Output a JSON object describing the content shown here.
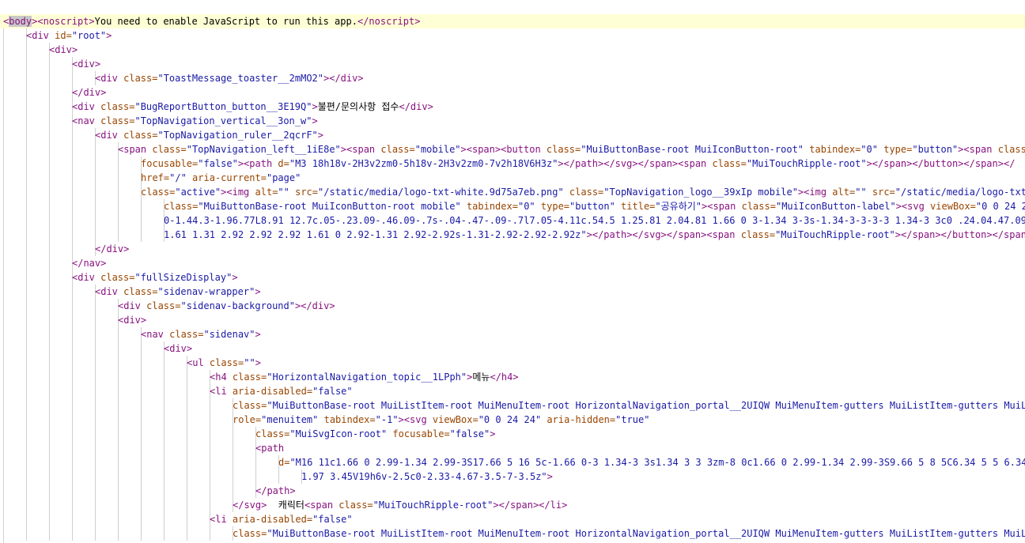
{
  "colors": {
    "tag": "#881280",
    "attr": "#994500",
    "value": "#1a1aa6",
    "text": "#000000",
    "line_highlight": "#ffffd5",
    "token_highlight": "#c8c8c8"
  },
  "lines": [
    {
      "indent": 0,
      "highlight": true,
      "tokens": [
        {
          "t": "tag",
          "v": "<"
        },
        {
          "t": "hl",
          "v": "body"
        },
        {
          "t": "tag",
          "v": "><noscript>"
        },
        {
          "t": "text",
          "v": "You need to enable JavaScript to run this app."
        },
        {
          "t": "tag",
          "v": "</noscript>"
        }
      ]
    },
    {
      "indent": 1,
      "tokens": [
        {
          "t": "tag",
          "v": "<div "
        },
        {
          "t": "attr",
          "v": "id="
        },
        {
          "t": "val",
          "v": "\"root\""
        },
        {
          "t": "tag",
          "v": ">"
        }
      ]
    },
    {
      "indent": 2,
      "tokens": [
        {
          "t": "tag",
          "v": "<div>"
        }
      ]
    },
    {
      "indent": 3,
      "tokens": [
        {
          "t": "tag",
          "v": "<div>"
        }
      ]
    },
    {
      "indent": 4,
      "tokens": [
        {
          "t": "tag",
          "v": "<div "
        },
        {
          "t": "attr",
          "v": "class="
        },
        {
          "t": "val",
          "v": "\"ToastMessage_toaster__2mMO2\""
        },
        {
          "t": "tag",
          "v": "></div>"
        }
      ]
    },
    {
      "indent": 3,
      "tokens": [
        {
          "t": "tag",
          "v": "</div>"
        }
      ]
    },
    {
      "indent": 3,
      "tokens": [
        {
          "t": "tag",
          "v": "<div "
        },
        {
          "t": "attr",
          "v": "class="
        },
        {
          "t": "val",
          "v": "\"BugReportButton_button__3E19Q\""
        },
        {
          "t": "tag",
          "v": ">"
        },
        {
          "t": "text",
          "v": "불편/문의사항 접수"
        },
        {
          "t": "tag",
          "v": "</div>"
        }
      ]
    },
    {
      "indent": 3,
      "tokens": [
        {
          "t": "tag",
          "v": "<nav "
        },
        {
          "t": "attr",
          "v": "class="
        },
        {
          "t": "val",
          "v": "\"TopNavigation_vertical__3on_w\""
        },
        {
          "t": "tag",
          "v": ">"
        }
      ]
    },
    {
      "indent": 4,
      "tokens": [
        {
          "t": "tag",
          "v": "<div "
        },
        {
          "t": "attr",
          "v": "class="
        },
        {
          "t": "val",
          "v": "\"TopNavigation_ruler__2qcrF\""
        },
        {
          "t": "tag",
          "v": ">"
        }
      ]
    },
    {
      "indent": 5,
      "tokens": [
        {
          "t": "tag",
          "v": "<span "
        },
        {
          "t": "attr",
          "v": "class="
        },
        {
          "t": "val",
          "v": "\"TopNavigation_left__1iE8e\""
        },
        {
          "t": "tag",
          "v": "><span "
        },
        {
          "t": "attr",
          "v": "class="
        },
        {
          "t": "val",
          "v": "\"mobile\""
        },
        {
          "t": "tag",
          "v": "><span><button "
        },
        {
          "t": "attr",
          "v": "class="
        },
        {
          "t": "val",
          "v": "\"MuiButtonBase-root MuiIconButton-root\""
        },
        {
          "t": "tag",
          "v": " "
        },
        {
          "t": "attr",
          "v": "tabindex="
        },
        {
          "t": "val",
          "v": "\"0\""
        },
        {
          "t": "tag",
          "v": " "
        },
        {
          "t": "attr",
          "v": "type="
        },
        {
          "t": "val",
          "v": "\"button\""
        },
        {
          "t": "tag",
          "v": "><span "
        },
        {
          "t": "attr",
          "v": "class"
        }
      ]
    },
    {
      "indent": 6,
      "tokens": [
        {
          "t": "attr",
          "v": "focusable="
        },
        {
          "t": "val",
          "v": "\"false\""
        },
        {
          "t": "tag",
          "v": "><path "
        },
        {
          "t": "attr",
          "v": "d="
        },
        {
          "t": "val",
          "v": "\"M3 18h18v-2H3v2zm0-5h18v-2H3v2zm0-7v2h18V6H3z\""
        },
        {
          "t": "tag",
          "v": "></path></svg></span><span "
        },
        {
          "t": "attr",
          "v": "class="
        },
        {
          "t": "val",
          "v": "\"MuiTouchRipple-root\""
        },
        {
          "t": "tag",
          "v": "></span></button></span></"
        }
      ]
    },
    {
      "indent": 6,
      "tokens": [
        {
          "t": "attr",
          "v": "href="
        },
        {
          "t": "val",
          "v": "\"/\""
        },
        {
          "t": "tag",
          "v": " "
        },
        {
          "t": "attr",
          "v": "aria-current="
        },
        {
          "t": "val",
          "v": "\"page\""
        }
      ]
    },
    {
      "indent": 6,
      "tokens": [
        {
          "t": "attr",
          "v": "class="
        },
        {
          "t": "val",
          "v": "\"active\""
        },
        {
          "t": "tag",
          "v": "><img "
        },
        {
          "t": "attr",
          "v": "alt="
        },
        {
          "t": "val",
          "v": "\"\""
        },
        {
          "t": "tag",
          "v": " "
        },
        {
          "t": "attr",
          "v": "src="
        },
        {
          "t": "val",
          "v": "\"/static/media/logo-txt-white.9d75a7eb.png\""
        },
        {
          "t": "tag",
          "v": " "
        },
        {
          "t": "attr",
          "v": "class="
        },
        {
          "t": "val",
          "v": "\"TopNavigation_logo__39xIp mobile\""
        },
        {
          "t": "tag",
          "v": "><img "
        },
        {
          "t": "attr",
          "v": "alt="
        },
        {
          "t": "val",
          "v": "\"\""
        },
        {
          "t": "tag",
          "v": " "
        },
        {
          "t": "attr",
          "v": "src="
        },
        {
          "t": "val",
          "v": "\"/static/media/logo-txt"
        }
      ]
    },
    {
      "indent": 7,
      "tokens": [
        {
          "t": "attr",
          "v": "class="
        },
        {
          "t": "val",
          "v": "\"MuiButtonBase-root MuiIconButton-root mobile\""
        },
        {
          "t": "tag",
          "v": " "
        },
        {
          "t": "attr",
          "v": "tabindex="
        },
        {
          "t": "val",
          "v": "\"0\""
        },
        {
          "t": "tag",
          "v": " "
        },
        {
          "t": "attr",
          "v": "type="
        },
        {
          "t": "val",
          "v": "\"button\""
        },
        {
          "t": "tag",
          "v": " "
        },
        {
          "t": "attr",
          "v": "title="
        },
        {
          "t": "val",
          "v": "\"공유하기\""
        },
        {
          "t": "tag",
          "v": "><span "
        },
        {
          "t": "attr",
          "v": "class="
        },
        {
          "t": "val",
          "v": "\"MuiIconButton-label\""
        },
        {
          "t": "tag",
          "v": "><svg "
        },
        {
          "t": "attr",
          "v": "viewBox="
        },
        {
          "t": "val",
          "v": "\"0 0 24 24"
        }
      ]
    },
    {
      "indent": 7,
      "tokens": [
        {
          "t": "val",
          "v": "0-1.44.3-1.96.77L8.91 12.7c.05-.23.09-.46.09-.7s-.04-.47-.09-.7l7.05-4.11c.54.5 1.25.81 2.04.81 1.66 0 3-1.34 3-3s-1.34-3-3-3-3 1.34-3 3c0 .24.04.47.09"
        }
      ]
    },
    {
      "indent": 7,
      "tokens": [
        {
          "t": "val",
          "v": "1.61 1.31 2.92 2.92 2.92 1.61 0 2.92-1.31 2.92-2.92s-1.31-2.92-2.92-2.92z\""
        },
        {
          "t": "tag",
          "v": "></path></svg></span><span "
        },
        {
          "t": "attr",
          "v": "class="
        },
        {
          "t": "val",
          "v": "\"MuiTouchRipple-root\""
        },
        {
          "t": "tag",
          "v": "></span></button></span>"
        }
      ]
    },
    {
      "indent": 4,
      "tokens": [
        {
          "t": "tag",
          "v": "</div>"
        }
      ]
    },
    {
      "indent": 3,
      "tokens": [
        {
          "t": "tag",
          "v": "</nav>"
        }
      ]
    },
    {
      "indent": 3,
      "tokens": [
        {
          "t": "tag",
          "v": "<div "
        },
        {
          "t": "attr",
          "v": "class="
        },
        {
          "t": "val",
          "v": "\"fullSizeDisplay\""
        },
        {
          "t": "tag",
          "v": ">"
        }
      ]
    },
    {
      "indent": 4,
      "tokens": [
        {
          "t": "tag",
          "v": "<div "
        },
        {
          "t": "attr",
          "v": "class="
        },
        {
          "t": "val",
          "v": "\"sidenav-wrapper\""
        },
        {
          "t": "tag",
          "v": ">"
        }
      ]
    },
    {
      "indent": 5,
      "tokens": [
        {
          "t": "tag",
          "v": "<div "
        },
        {
          "t": "attr",
          "v": "class="
        },
        {
          "t": "val",
          "v": "\"sidenav-background\""
        },
        {
          "t": "tag",
          "v": "></div>"
        }
      ]
    },
    {
      "indent": 5,
      "tokens": [
        {
          "t": "tag",
          "v": "<div>"
        }
      ]
    },
    {
      "indent": 6,
      "tokens": [
        {
          "t": "tag",
          "v": "<nav "
        },
        {
          "t": "attr",
          "v": "class="
        },
        {
          "t": "val",
          "v": "\"sidenav\""
        },
        {
          "t": "tag",
          "v": ">"
        }
      ]
    },
    {
      "indent": 7,
      "tokens": [
        {
          "t": "tag",
          "v": "<div>"
        }
      ]
    },
    {
      "indent": 8,
      "tokens": [
        {
          "t": "tag",
          "v": "<ul "
        },
        {
          "t": "attr",
          "v": "class="
        },
        {
          "t": "val",
          "v": "\"\""
        },
        {
          "t": "tag",
          "v": ">"
        }
      ]
    },
    {
      "indent": 9,
      "tokens": [
        {
          "t": "tag",
          "v": "<h4 "
        },
        {
          "t": "attr",
          "v": "class="
        },
        {
          "t": "val",
          "v": "\"HorizontalNavigation_topic__1LPph\""
        },
        {
          "t": "tag",
          "v": ">"
        },
        {
          "t": "text",
          "v": "메뉴"
        },
        {
          "t": "tag",
          "v": "</h4>"
        }
      ]
    },
    {
      "indent": 9,
      "tokens": [
        {
          "t": "tag",
          "v": "<li "
        },
        {
          "t": "attr",
          "v": "aria-disabled="
        },
        {
          "t": "val",
          "v": "\"false\""
        }
      ]
    },
    {
      "indent": 10,
      "tokens": [
        {
          "t": "attr",
          "v": "class="
        },
        {
          "t": "val",
          "v": "\"MuiButtonBase-root MuiListItem-root MuiMenuItem-root HorizontalNavigation_portal__2UIQW MuiMenuItem-gutters MuiListItem-gutters MuiL"
        }
      ]
    },
    {
      "indent": 10,
      "tokens": [
        {
          "t": "attr",
          "v": "role="
        },
        {
          "t": "val",
          "v": "\"menuitem\""
        },
        {
          "t": "tag",
          "v": " "
        },
        {
          "t": "attr",
          "v": "tabindex="
        },
        {
          "t": "val",
          "v": "\"-1\""
        },
        {
          "t": "tag",
          "v": "><svg "
        },
        {
          "t": "attr",
          "v": "viewBox="
        },
        {
          "t": "val",
          "v": "\"0 0 24 24\""
        },
        {
          "t": "tag",
          "v": " "
        },
        {
          "t": "attr",
          "v": "aria-hidden="
        },
        {
          "t": "val",
          "v": "\"true\""
        }
      ]
    },
    {
      "indent": 11,
      "tokens": [
        {
          "t": "attr",
          "v": "class="
        },
        {
          "t": "val",
          "v": "\"MuiSvgIcon-root\""
        },
        {
          "t": "tag",
          "v": " "
        },
        {
          "t": "attr",
          "v": "focusable="
        },
        {
          "t": "val",
          "v": "\"false\""
        },
        {
          "t": "tag",
          "v": ">"
        }
      ]
    },
    {
      "indent": 11,
      "tokens": [
        {
          "t": "tag",
          "v": "<path"
        }
      ]
    },
    {
      "indent": 12,
      "tokens": [
        {
          "t": "attr",
          "v": "d="
        },
        {
          "t": "val",
          "v": "\"M16 11c1.66 0 2.99-1.34 2.99-3S17.66 5 16 5c-1.66 0-3 1.34-3 3s1.34 3 3 3zm-8 0c1.66 0 2.99-1.34 2.99-3S9.66 5 8 5C6.34 5 5 6.34"
        }
      ]
    },
    {
      "indent": 13,
      "tokens": [
        {
          "t": "val",
          "v": "1.97 3.45V19h6v-2.5c0-2.33-4.67-3.5-7-3.5z\""
        },
        {
          "t": "tag",
          "v": ">"
        }
      ]
    },
    {
      "indent": 11,
      "tokens": [
        {
          "t": "tag",
          "v": "</path>"
        }
      ]
    },
    {
      "indent": 10,
      "tokens": [
        {
          "t": "tag",
          "v": "</svg>"
        },
        {
          "t": "text",
          "v": "  캐릭터"
        },
        {
          "t": "tag",
          "v": "<span "
        },
        {
          "t": "attr",
          "v": "class="
        },
        {
          "t": "val",
          "v": "\"MuiTouchRipple-root\""
        },
        {
          "t": "tag",
          "v": "></span></li>"
        }
      ]
    },
    {
      "indent": 9,
      "tokens": [
        {
          "t": "tag",
          "v": "<li "
        },
        {
          "t": "attr",
          "v": "aria-disabled="
        },
        {
          "t": "val",
          "v": "\"false\""
        }
      ]
    },
    {
      "indent": 10,
      "tokens": [
        {
          "t": "attr",
          "v": "class="
        },
        {
          "t": "val",
          "v": "\"MuiButtonBase-root MuiListItem-root MuiMenuItem-root HorizontalNavigation_portal__2UIQW MuiMenuItem-gutters MuiListItem-gutters MuiL"
        }
      ]
    }
  ]
}
